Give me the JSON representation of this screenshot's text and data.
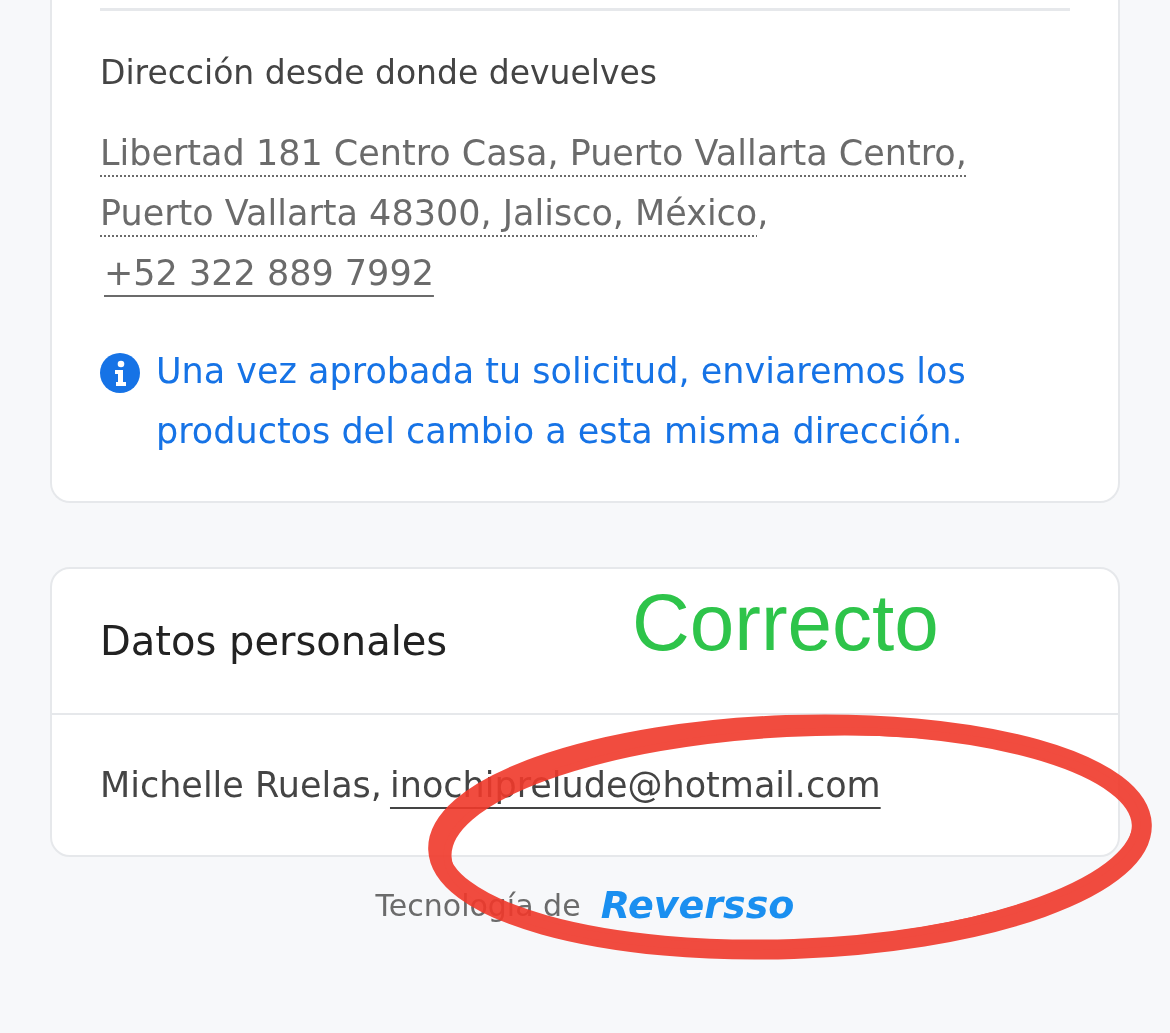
{
  "return_section": {
    "heading": "Dirección desde donde devuelves",
    "address": "Libertad 181 Centro Casa, Puerto Vallarta Centro, Puerto Vallarta 48300, Jalisco, México",
    "separator": ",",
    "phone": "+52 322 889 7992",
    "info": "Una vez aprobada tu solicitud, enviaremos los productos del cambio a esta misma dirección."
  },
  "personal_section": {
    "heading": "Datos personales",
    "name": "Michelle Ruelas,",
    "email": "inochiprelude@hotmail.com"
  },
  "footer": {
    "label": "Tecnología de",
    "brand": "Reversso"
  },
  "annotation": {
    "label": "Correcto"
  }
}
